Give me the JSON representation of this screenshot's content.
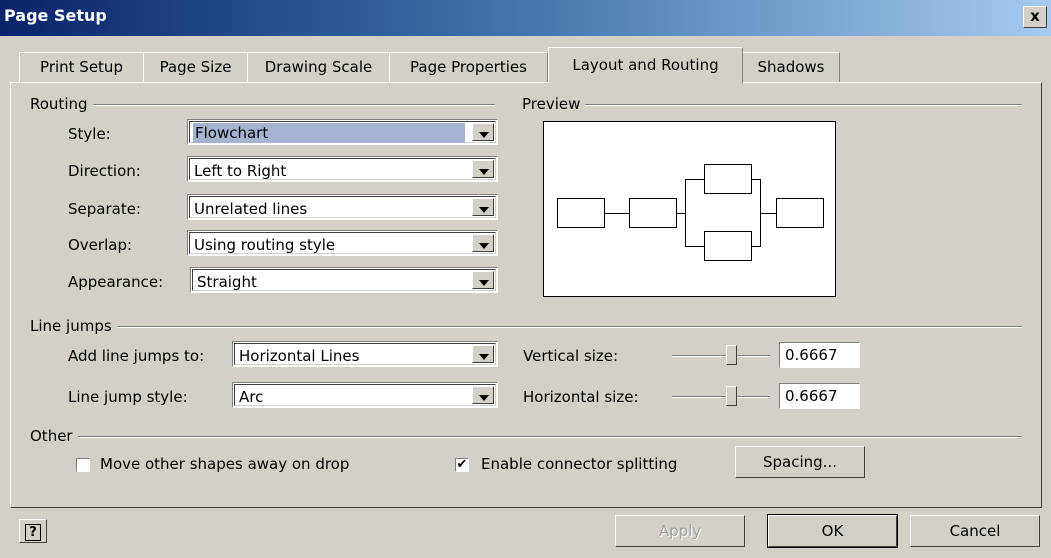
{
  "window": {
    "title": "Page Setup",
    "close_label": "x"
  },
  "tabs": [
    "Print Setup",
    "Page Size",
    "Drawing Scale",
    "Page Properties",
    "Layout and Routing",
    "Shadows"
  ],
  "active_tab": "Layout and Routing",
  "routing": {
    "header": "Routing",
    "style_label": "Style:",
    "style_value": "Flowchart",
    "direction_label": "Direction:",
    "direction_value": "Left to Right",
    "separate_label": "Separate:",
    "separate_value": "Unrelated lines",
    "overlap_label": "Overlap:",
    "overlap_value": "Using routing style",
    "appearance_label": "Appearance:",
    "appearance_value": "Straight"
  },
  "preview": {
    "header": "Preview"
  },
  "line_jumps": {
    "header": "Line jumps",
    "add_label": "Add line jumps to:",
    "add_value": "Horizontal Lines",
    "style_label": "Line jump style:",
    "style_value": "Arc",
    "vertical_label": "Vertical size:",
    "vertical_value": "0.6667",
    "horizontal_label": "Horizontal size:",
    "horizontal_value": "0.6667"
  },
  "other": {
    "header": "Other",
    "move_label": "Move other shapes away on drop",
    "move_checked": false,
    "split_label": "Enable connector splitting",
    "split_checked": true,
    "split_mark": "✔",
    "spacing_label": "Spacing..."
  },
  "buttons": {
    "help": "?",
    "apply": "Apply",
    "ok": "OK",
    "cancel": "Cancel"
  }
}
